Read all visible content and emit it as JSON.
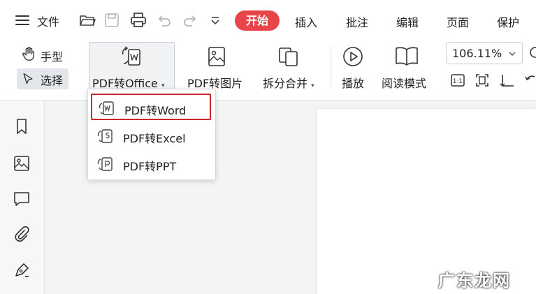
{
  "menu": {
    "file_label": "文件",
    "tabs": [
      {
        "label": "开始"
      },
      {
        "label": "插入"
      },
      {
        "label": "批注"
      },
      {
        "label": "编辑"
      },
      {
        "label": "页面"
      },
      {
        "label": "保护"
      }
    ]
  },
  "ribbon": {
    "hand_label": "手型",
    "select_label": "选择",
    "pdf_to_office_label": "PDF转Office",
    "pdf_to_image_label": "PDF转图片",
    "split_merge_label": "拆分合并",
    "play_label": "播放",
    "read_mode_label": "阅读模式",
    "zoom_value": "106.11%"
  },
  "dropdown": {
    "items": [
      {
        "label": "PDF转Word",
        "icon": "word-convert-icon"
      },
      {
        "label": "PDF转Excel",
        "icon": "excel-convert-icon"
      },
      {
        "label": "PDF转PPT",
        "icon": "ppt-convert-icon"
      }
    ],
    "highlight_color": "#d1242b"
  },
  "watermark": "广东龙网",
  "colors": {
    "accent": "#e8454a"
  }
}
